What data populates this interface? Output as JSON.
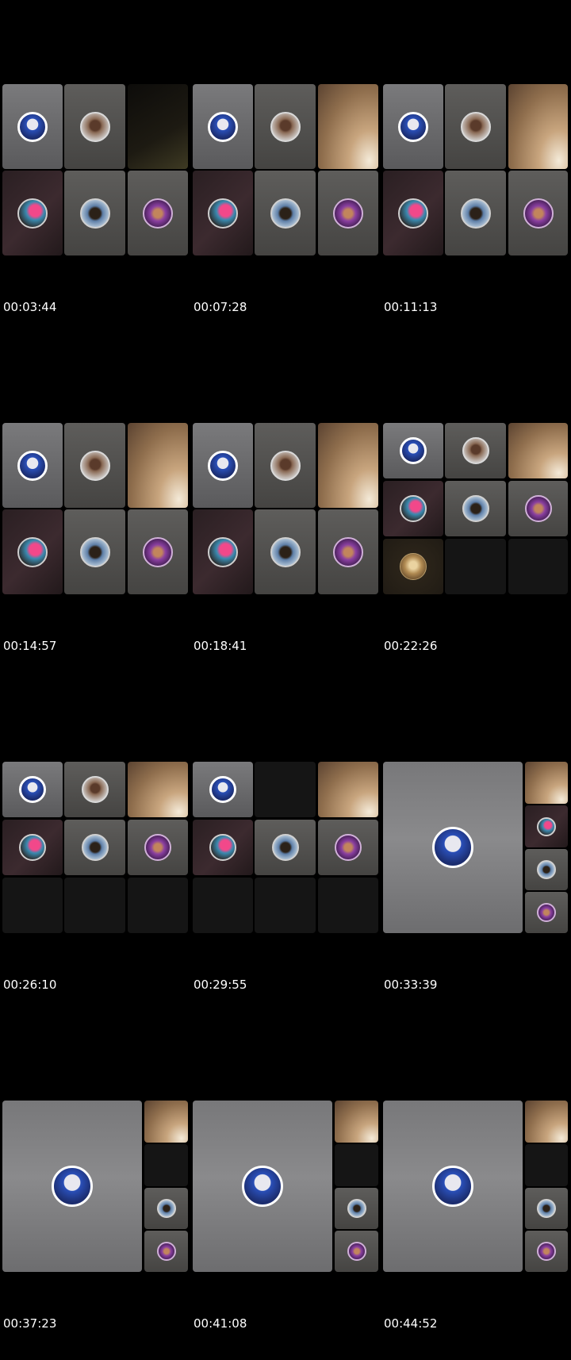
{
  "frames": [
    {
      "timestamp": "00:03:44"
    },
    {
      "timestamp": "00:07:28"
    },
    {
      "timestamp": "00:11:13"
    },
    {
      "timestamp": "00:14:57"
    },
    {
      "timestamp": "00:18:41"
    },
    {
      "timestamp": "00:22:26"
    },
    {
      "timestamp": "00:26:10"
    },
    {
      "timestamp": "00:29:55"
    },
    {
      "timestamp": "00:33:39"
    },
    {
      "timestamp": "00:37:23"
    },
    {
      "timestamp": "00:41:08"
    },
    {
      "timestamp": "00:44:52"
    }
  ]
}
